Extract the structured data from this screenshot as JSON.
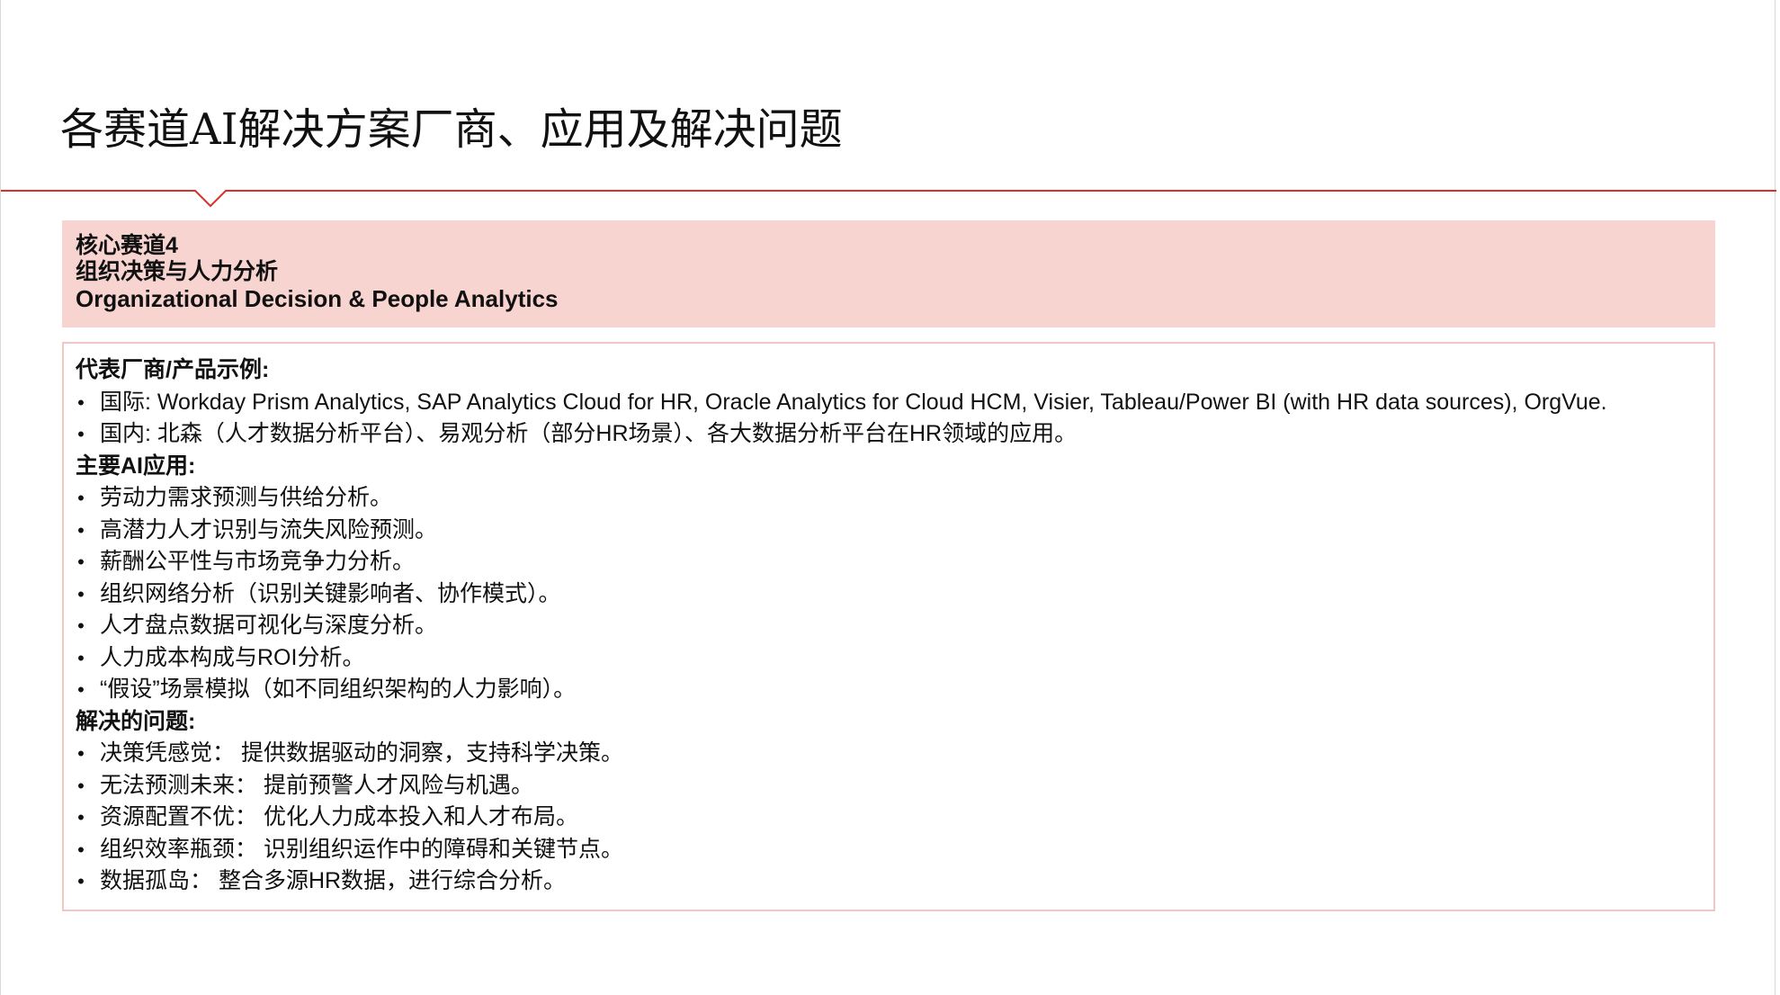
{
  "page": {
    "title": "各赛道AI解决方案厂商、应用及解决问题"
  },
  "colors": {
    "accent_red": "#d9302a",
    "header_fill": "#f8d4d1",
    "content_border": "#f2c6c2"
  },
  "header": {
    "line1": "核心赛道4",
    "line2": "组织决策与人力分析",
    "line3": "Organizational Decision & People Analytics"
  },
  "content": {
    "vendors_heading": "代表厂商/产品示例:",
    "vendors": [
      "国际: Workday Prism Analytics, SAP Analytics Cloud for HR, Oracle Analytics for Cloud HCM, Visier, Tableau/Power BI (with HR data sources), OrgVue.",
      "国内: 北森（人才数据分析平台）、易观分析（部分HR场景）、各大数据分析平台在HR领域的应用。"
    ],
    "applications_heading": "主要AI应用:",
    "applications": [
      "劳动力需求预测与供给分析。",
      "高潜力人才识别与流失风险预测。",
      "薪酬公平性与市场竞争力分析。",
      "组织网络分析（识别关键影响者、协作模式）。",
      "人才盘点数据可视化与深度分析。",
      "人力成本构成与ROI分析。",
      "“假设”场景模拟（如不同组织架构的人力影响）。"
    ],
    "problems_heading": "解决的问题:",
    "problems": [
      "决策凭感觉： 提供数据驱动的洞察，支持科学决策。",
      "无法预测未来： 提前预警人才风险与机遇。",
      "资源配置不优： 优化人力成本投入和人才布局。",
      "组织效率瓶颈： 识别组织运作中的障碍和关键节点。",
      "数据孤岛： 整合多源HR数据，进行综合分析。"
    ],
    "bullet_symbol": "•"
  }
}
